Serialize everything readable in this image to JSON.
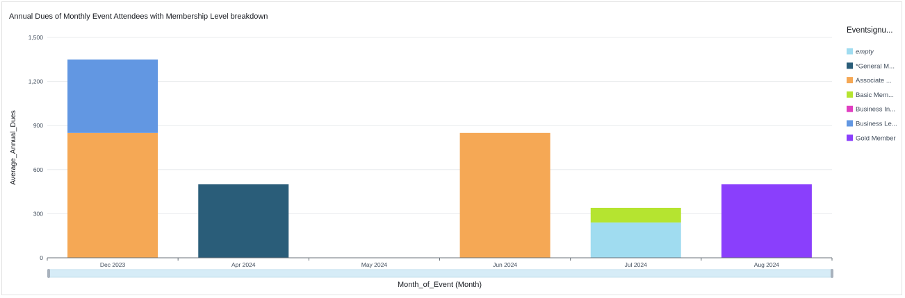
{
  "chart_data": {
    "type": "bar",
    "stacked": true,
    "title": "Annual Dues of Monthly Event Attendees with Membership Level breakdown",
    "xlabel": "Month_of_Event (Month)",
    "ylabel": "Average_Annual_Dues",
    "ylim": [
      0,
      1500
    ],
    "yticks": [
      "0",
      "300",
      "600",
      "900",
      "1,200",
      "1,500"
    ],
    "ytick_values": [
      0,
      300,
      600,
      900,
      1200,
      1500
    ],
    "grid": true,
    "categories": [
      "Dec 2023",
      "Apr 2024",
      "May 2024",
      "Jun 2024",
      "Jul 2024",
      "Aug 2024"
    ],
    "legend_title": "Eventsignu...",
    "legend_position": "right",
    "series": [
      {
        "name": "empty",
        "color": "#a0dcf0",
        "values": [
          0,
          0,
          0,
          0,
          240,
          0
        ]
      },
      {
        "name": "*General M...",
        "color": "#2a5d79",
        "values": [
          0,
          500,
          0,
          0,
          0,
          0
        ]
      },
      {
        "name": "Associate ...",
        "color": "#f5a855",
        "values": [
          850,
          0,
          0,
          850,
          0,
          0
        ]
      },
      {
        "name": "Basic Mem...",
        "color": "#b5e430",
        "values": [
          0,
          0,
          0,
          0,
          100,
          0
        ]
      },
      {
        "name": "Business In...",
        "color": "#e03fc1",
        "values": [
          0,
          0,
          0,
          0,
          0,
          0
        ]
      },
      {
        "name": "Business Le...",
        "color": "#6297e2",
        "values": [
          500,
          0,
          0,
          0,
          0,
          0
        ]
      },
      {
        "name": "Gold Member",
        "color": "#8a3ffc",
        "values": [
          0,
          0,
          0,
          0,
          0,
          500
        ]
      }
    ]
  }
}
